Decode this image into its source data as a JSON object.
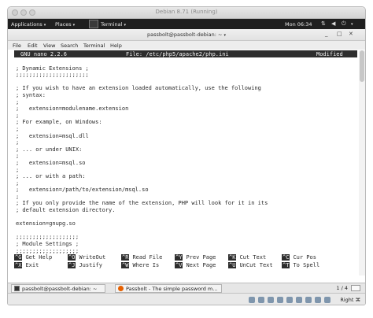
{
  "host_window": {
    "title": "Debian 8.71 (Running)"
  },
  "topbar": {
    "applications": "Applications",
    "places": "Places",
    "terminal": "Terminal",
    "clock": "Mon 06:34"
  },
  "terminal": {
    "title": "passbolt@passbolt-debian: ~",
    "menu": [
      "File",
      "Edit",
      "View",
      "Search",
      "Terminal",
      "Help"
    ]
  },
  "nano": {
    "version": "GNU nano 2.2.6",
    "file": "File: /etc/php5/apache2/php.ini",
    "status": "Modified",
    "lines": [
      "",
      "; Dynamic Extensions ;",
      ";;;;;;;;;;;;;;;;;;;;;;",
      "",
      "; If you wish to have an extension loaded automatically, use the following",
      "; syntax:",
      ";",
      ";   extension=modulename.extension",
      ";",
      "; For example, on Windows:",
      ";",
      ";   extension=msql.dll",
      ";",
      "; ... or under UNIX:",
      ";",
      ";   extension=msql.so",
      ";",
      "; ... or with a path:",
      ";",
      ";   extension=/path/to/extension/msql.so",
      ";",
      "; If you only provide the name of the extension, PHP will look for it in its",
      "; default extension directory.",
      "",
      "extension=gnupg.so",
      "",
      ";;;;;;;;;;;;;;;;;;;",
      "; Module Settings ;",
      ";;;;;;;;;;;;;;;;;;;"
    ],
    "shortcuts": [
      {
        "key": "^G",
        "label": "Get Help"
      },
      {
        "key": "^O",
        "label": "WriteOut"
      },
      {
        "key": "^R",
        "label": "Read File"
      },
      {
        "key": "^Y",
        "label": "Prev Page"
      },
      {
        "key": "^K",
        "label": "Cut Text"
      },
      {
        "key": "^C",
        "label": "Cur Pos"
      },
      {
        "key": "^X",
        "label": "Exit"
      },
      {
        "key": "^J",
        "label": "Justify"
      },
      {
        "key": "^W",
        "label": "Where Is"
      },
      {
        "key": "^V",
        "label": "Next Page"
      },
      {
        "key": "^U",
        "label": "UnCut Text"
      },
      {
        "key": "^T",
        "label": "To Spell"
      }
    ]
  },
  "taskbar": {
    "tasks": [
      {
        "label": "passbolt@passbolt-debian: ~"
      },
      {
        "label": "Passbolt - The simple password m..."
      }
    ],
    "pager": "1 / 4"
  },
  "vbox_status": {
    "host_key": "Right ⌘"
  },
  "colors": {
    "topbar": "#1f1f1f",
    "nano_bar": "#2d2d2d",
    "firefox": "#e66000"
  }
}
